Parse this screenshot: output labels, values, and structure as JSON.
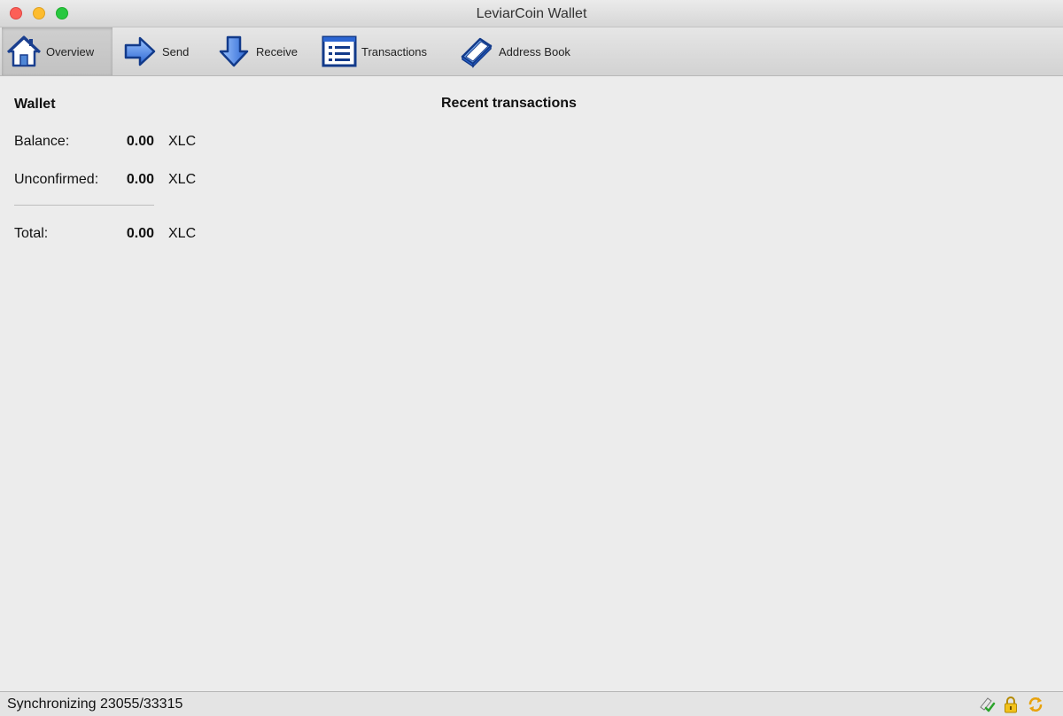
{
  "window": {
    "title": "LeviarCoin Wallet"
  },
  "toolbar": {
    "items": [
      {
        "label": "Overview",
        "icon": "home-icon",
        "active": true
      },
      {
        "label": "Send",
        "icon": "send-arrow-icon",
        "active": false
      },
      {
        "label": "Receive",
        "icon": "receive-arrow-icon",
        "active": false
      },
      {
        "label": "Transactions",
        "icon": "list-icon",
        "active": false
      },
      {
        "label": "Address Book",
        "icon": "address-book-icon",
        "active": false
      }
    ]
  },
  "wallet": {
    "title": "Wallet",
    "balance_label": "Balance:",
    "balance_value": "0.00",
    "unconfirmed_label": "Unconfirmed:",
    "unconfirmed_value": "0.00",
    "total_label": "Total:",
    "total_value": "0.00",
    "unit": "XLC"
  },
  "recent": {
    "title": "Recent transactions"
  },
  "status": {
    "text": "Synchronizing 23055/33315",
    "icons": [
      "connections-icon",
      "lock-icon",
      "sync-icon"
    ]
  },
  "colors": {
    "accent_blue": "#1f5fbf",
    "background": "#ececec"
  }
}
